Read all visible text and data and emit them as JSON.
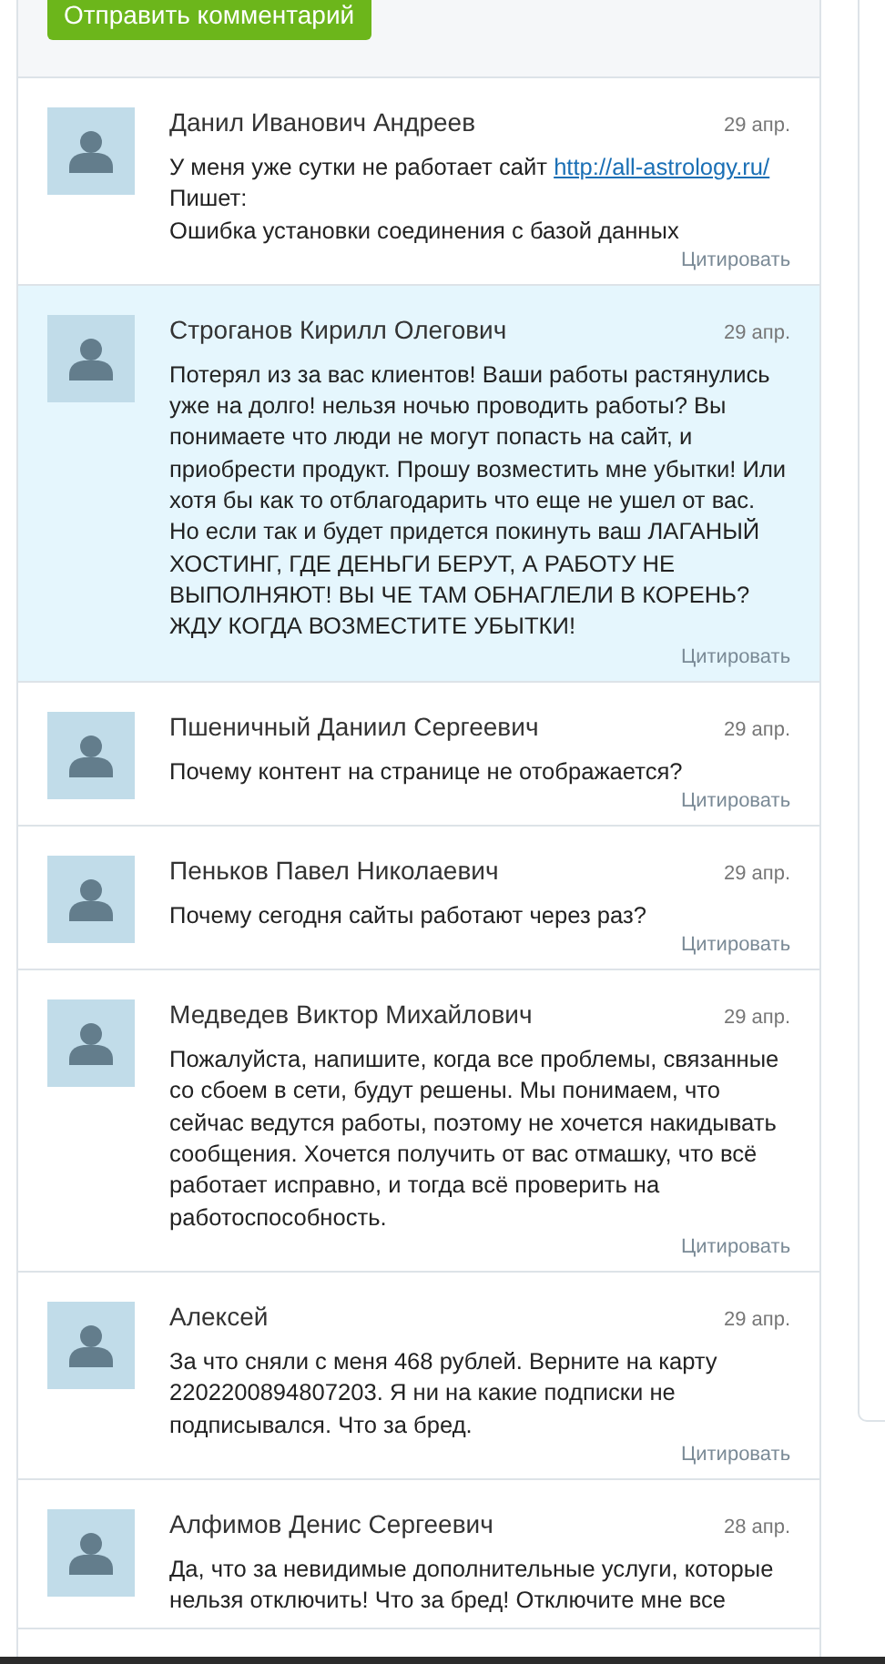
{
  "form": {
    "submit_button": "Отправить комментарий"
  },
  "comments": [
    {
      "author": "Данил Иванович Андреев",
      "date": "29 апр.",
      "highlighted": false,
      "body": [
        {
          "kind": "text",
          "text": "У меня уже сутки не работает сайт "
        },
        {
          "kind": "link",
          "text": "http://all-astrology.ru/"
        },
        {
          "kind": "text",
          "text": "\nПишет:\nОшибка установки соединения с базой данных"
        }
      ],
      "quote_link": "Цитировать"
    },
    {
      "author": "Строганов Кирилл Олегович",
      "date": "29 апр.",
      "highlighted": true,
      "body": [
        {
          "kind": "text",
          "text": "Потерял из за вас клиентов! Ваши работы растянулись уже на долго! нельзя ночью проводить работы? Вы понимаете что люди не могут попасть на сайт, и приобрести продукт. Прошу возместить мне убытки! Или хотя бы как то отблагодарить что еще не ушел от вас. Но если так и будет придется покинуть ваш ЛАГАНЫЙ ХОСТИНГ, ГДЕ ДЕНЬГИ БЕРУТ, А РАБОТУ НЕ ВЫПОЛНЯЮТ! ВЫ ЧЕ ТАМ ОБНАГЛЕЛИ В КОРЕНЬ? ЖДУ КОГДА ВОЗМЕСТИТЕ УБЫТКИ!"
        }
      ],
      "quote_link": "Цитировать"
    },
    {
      "author": "Пшеничный Даниил Сергеевич",
      "date": "29 апр.",
      "highlighted": false,
      "body": [
        {
          "kind": "text",
          "text": "Почему контент на странице не отображается?"
        }
      ],
      "quote_link": "Цитировать"
    },
    {
      "author": "Пеньков Павел Николаевич",
      "date": "29 апр.",
      "highlighted": false,
      "body": [
        {
          "kind": "text",
          "text": "Почему сегодня сайты работают через раз?"
        }
      ],
      "quote_link": "Цитировать"
    },
    {
      "author": "Медведев Виктор Михайлович",
      "date": "29 апр.",
      "highlighted": false,
      "body": [
        {
          "kind": "text",
          "text": "Пожалуйста, напишите, когда все проблемы, связанные со сбоем в сети, будут решены. Мы понимаем, что сейчас ведутся работы, поэтому не хочется накидывать сообщения. Хочется получить от вас отмашку, что всё работает исправно, и тогда всё проверить на работоспособность."
        }
      ],
      "quote_link": "Цитировать"
    },
    {
      "author": "Алексей",
      "date": "29 апр.",
      "highlighted": false,
      "body": [
        {
          "kind": "text",
          "text": "За что сняли с меня 468 рублей. Верните на карту 2202200894807203. Я ни на какие подписки не подписывался. Что за бред."
        }
      ],
      "quote_link": "Цитировать"
    },
    {
      "author": "Алфимов Денис Сергеевич",
      "date": "28 апр.",
      "highlighted": false,
      "body": [
        {
          "kind": "text",
          "text": "Да, что за невидимые дополнительные услуги, которые нельзя отключить! Что за бред! Отключите мне все"
        }
      ]
    }
  ]
}
